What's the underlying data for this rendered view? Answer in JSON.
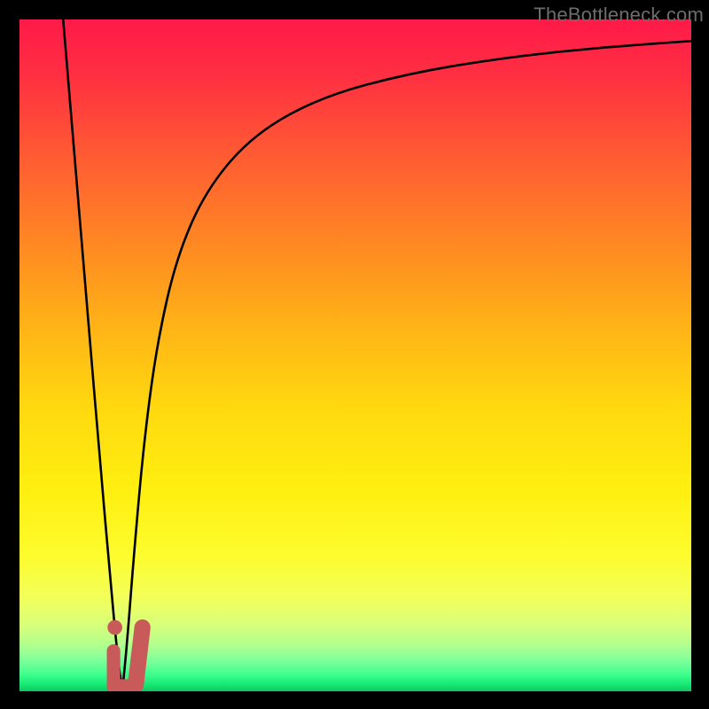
{
  "watermark": {
    "text": "TheBottleneck.com"
  },
  "colors": {
    "background": "#000000",
    "curve_stroke": "#000000",
    "marker_fill": "#c95a5a",
    "gradient_top": "#ff1a49",
    "gradient_bottom": "#10c85e"
  },
  "chart_data": {
    "type": "line",
    "title": "",
    "xlabel": "",
    "ylabel": "",
    "xlim": [
      0,
      100
    ],
    "ylim": [
      0,
      100
    ],
    "grid": false,
    "series": [
      {
        "name": "left-branch",
        "x": [
          6.5,
          8.0,
          10.0,
          12.0,
          13.5,
          14.5,
          15.3
        ],
        "values": [
          100,
          82,
          58,
          34,
          17,
          6,
          0
        ]
      },
      {
        "name": "right-branch",
        "x": [
          15.3,
          16.0,
          17.0,
          18.5,
          20.5,
          23.5,
          28.0,
          35.0,
          45.0,
          58.0,
          72.0,
          86.0,
          100.0
        ],
        "values": [
          0,
          7,
          20,
          37,
          52,
          65,
          75,
          83,
          88.5,
          92,
          94.3,
          95.8,
          96.8
        ]
      }
    ],
    "markers": [
      {
        "name": "dot-upper",
        "x": 14.2,
        "y": 9.5,
        "r": 1.1
      },
      {
        "name": "blob-left-vertical",
        "shape": "capsule",
        "x0": 14.0,
        "y0": 6.0,
        "x1": 14.0,
        "y1": 0.5,
        "w": 2.0
      },
      {
        "name": "blob-right-foot",
        "shape": "capsule",
        "x0": 14.5,
        "y0": 0.8,
        "x1": 16.8,
        "y1": 0.8,
        "w": 2.0
      },
      {
        "name": "blob-right-up",
        "shape": "capsule",
        "x0": 17.3,
        "y0": 1.0,
        "x1": 18.3,
        "y1": 9.5,
        "w": 2.4
      }
    ]
  }
}
